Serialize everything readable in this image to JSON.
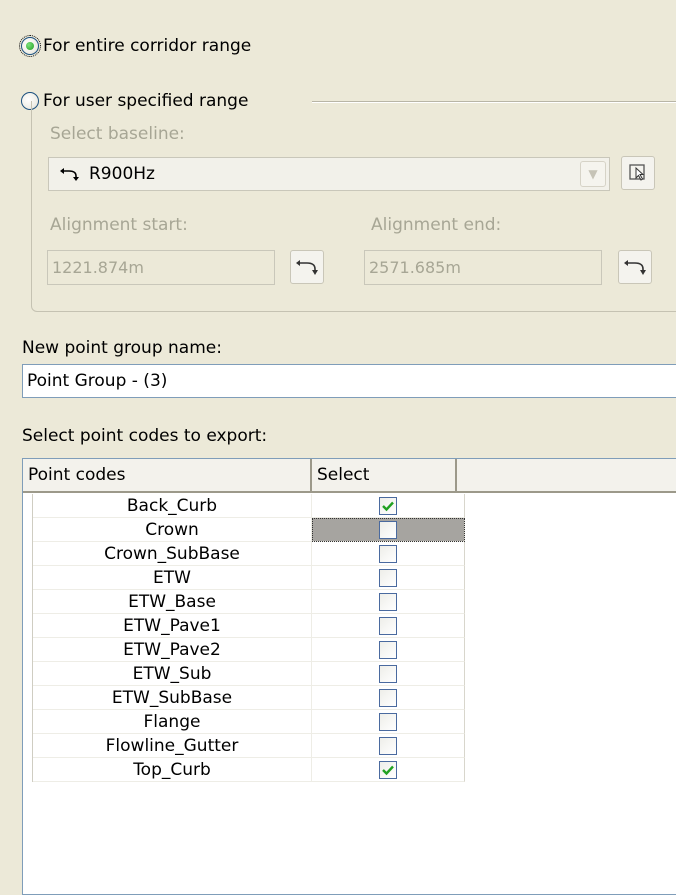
{
  "range": {
    "entire_label": "For entire corridor range",
    "user_label": "For user specified range",
    "selected": "entire"
  },
  "baseline": {
    "label": "Select baseline:",
    "value": "R900Hz"
  },
  "alignment": {
    "start_label": "Alignment start:",
    "start_value": "1221.874m",
    "end_label": "Alignment end:",
    "end_value": "2571.685m"
  },
  "point_group": {
    "label": "New point group name:",
    "value": "Point Group - (3)"
  },
  "codes": {
    "label": "Select point codes to export:",
    "col_codes": "Point codes",
    "col_select": "Select",
    "rows": [
      {
        "code": "Back_Curb",
        "checked": true
      },
      {
        "code": "Crown",
        "checked": false
      },
      {
        "code": "Crown_SubBase",
        "checked": false
      },
      {
        "code": "ETW",
        "checked": false
      },
      {
        "code": "ETW_Base",
        "checked": false
      },
      {
        "code": "ETW_Pave1",
        "checked": false
      },
      {
        "code": "ETW_Pave2",
        "checked": false
      },
      {
        "code": "ETW_Sub",
        "checked": false
      },
      {
        "code": "ETW_SubBase",
        "checked": false
      },
      {
        "code": "Flange",
        "checked": false
      },
      {
        "code": "Flowline_Gutter",
        "checked": false
      },
      {
        "code": "Top_Curb",
        "checked": true
      }
    ]
  },
  "colors": {
    "check_green": "#21a121",
    "selected_cell": "#a6a4a0"
  }
}
